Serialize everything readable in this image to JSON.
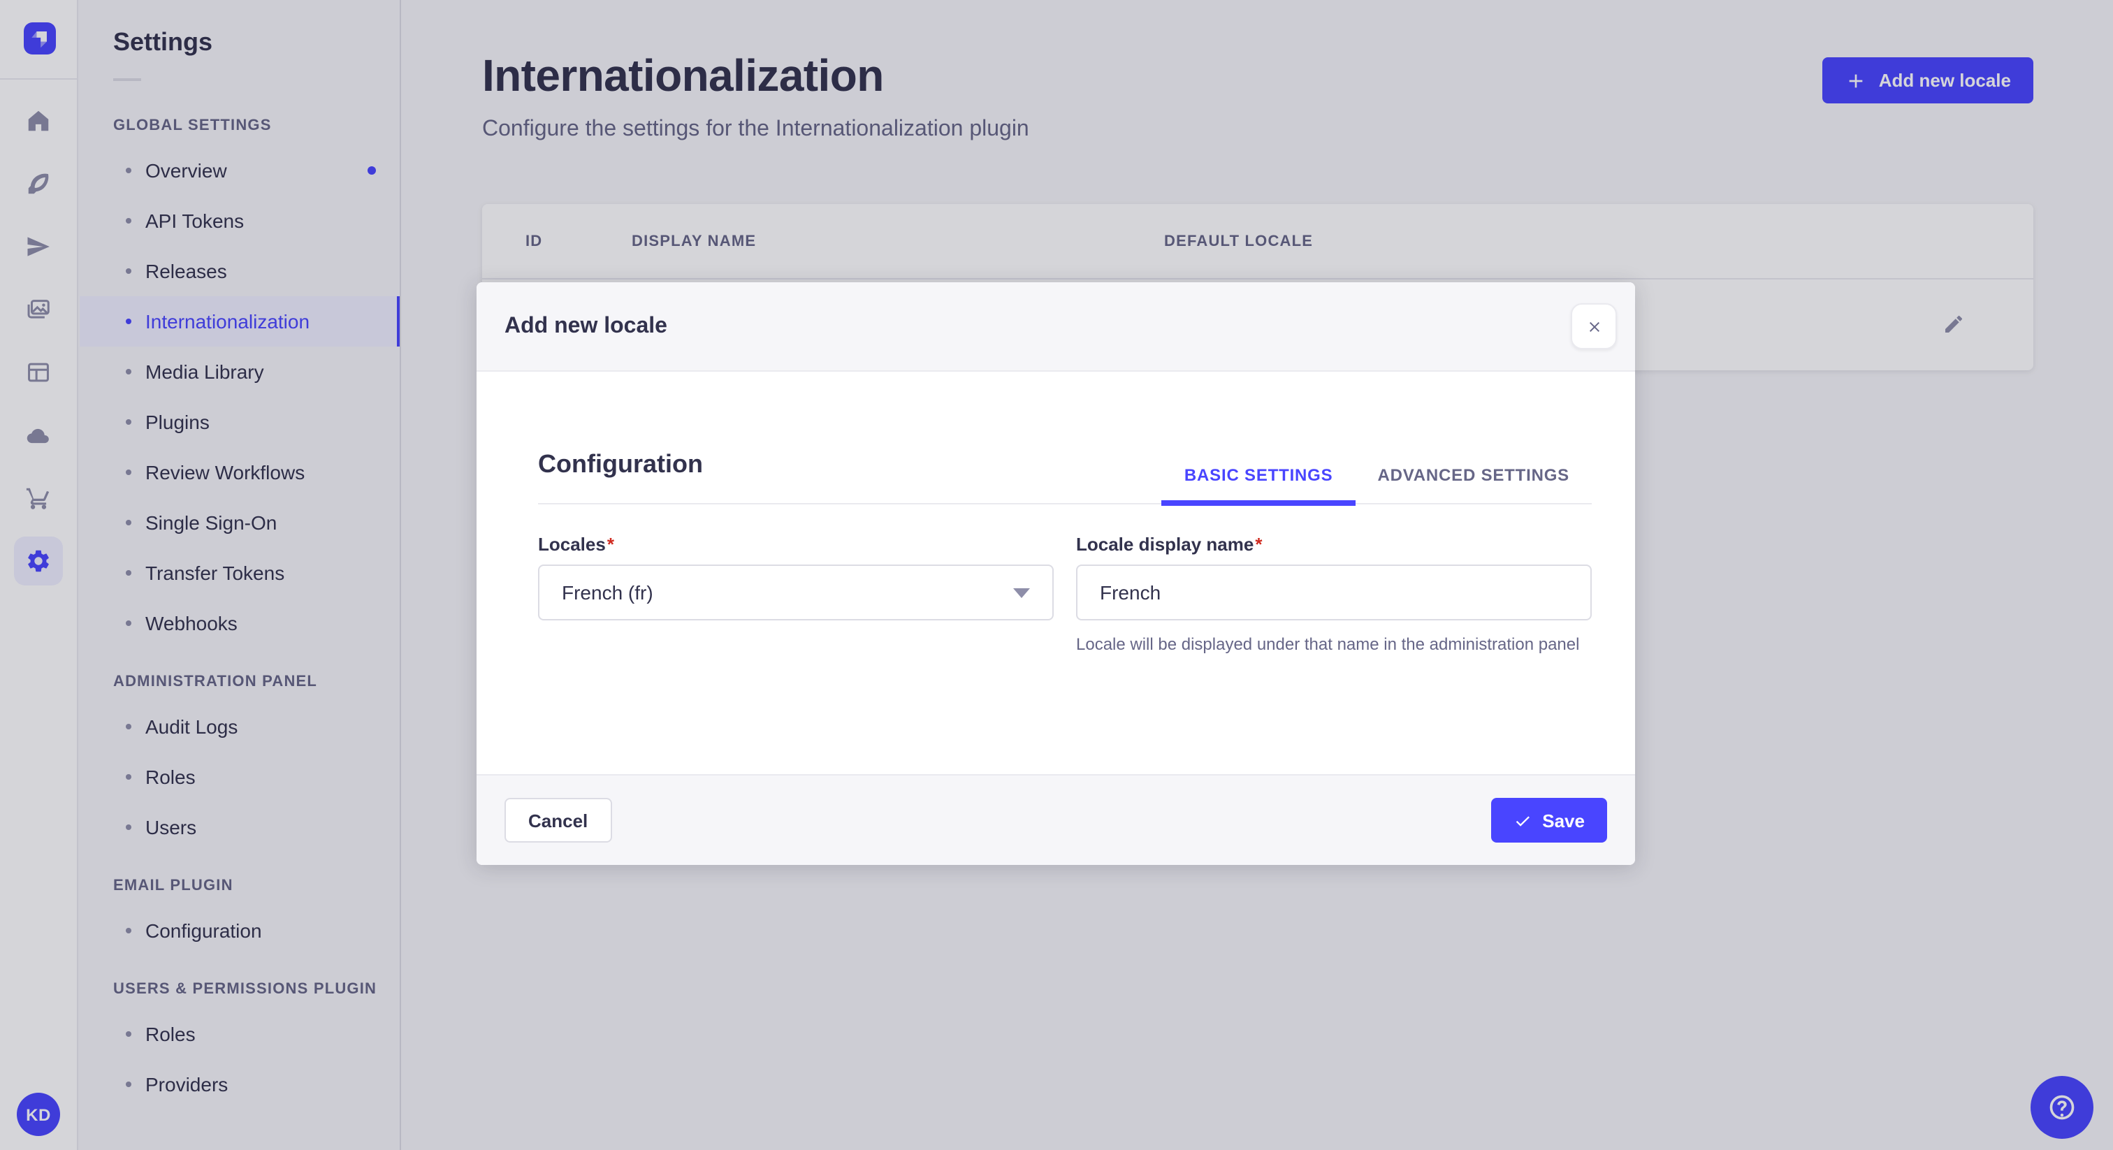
{
  "colors": {
    "primary": "#4945ff",
    "primary_light_bg": "#f0f0ff",
    "text_dark": "#32324d",
    "text_muted": "#666687",
    "icon_gray": "#8e8ea9",
    "border": "#dcdce4",
    "divider": "#eaeaef",
    "surface": "#ffffff",
    "app_bg": "#f6f6f9",
    "required_red": "#d02b20"
  },
  "rail": {
    "logo_icon": "strapi-logo",
    "icons": [
      {
        "name": "home",
        "glyph": "home",
        "active": false
      },
      {
        "name": "content-manager",
        "glyph": "feather",
        "active": false
      },
      {
        "name": "deploy",
        "glyph": "plane",
        "active": false
      },
      {
        "name": "media-library",
        "glyph": "media",
        "active": false
      },
      {
        "name": "content-type-builder",
        "glyph": "layout",
        "active": false
      },
      {
        "name": "cloud",
        "glyph": "cloud",
        "active": false
      },
      {
        "name": "marketplace",
        "glyph": "cart",
        "active": false
      },
      {
        "name": "settings-gear",
        "glyph": "gear",
        "active": true
      }
    ],
    "avatar_initials": "KD"
  },
  "subnav": {
    "title": "Settings",
    "sections": [
      {
        "label": "GLOBAL SETTINGS",
        "items": [
          {
            "label": "Overview",
            "notification": true
          },
          {
            "label": "API Tokens"
          },
          {
            "label": "Releases"
          },
          {
            "label": "Internationalization",
            "active": true
          },
          {
            "label": "Media Library"
          },
          {
            "label": "Plugins"
          },
          {
            "label": "Review Workflows"
          },
          {
            "label": "Single Sign-On"
          },
          {
            "label": "Transfer Tokens"
          },
          {
            "label": "Webhooks"
          }
        ]
      },
      {
        "label": "ADMINISTRATION PANEL",
        "items": [
          {
            "label": "Audit Logs"
          },
          {
            "label": "Roles"
          },
          {
            "label": "Users"
          }
        ]
      },
      {
        "label": "EMAIL PLUGIN",
        "items": [
          {
            "label": "Configuration"
          }
        ]
      },
      {
        "label": "USERS & PERMISSIONS PLUGIN",
        "items": [
          {
            "label": "Roles"
          },
          {
            "label": "Providers"
          }
        ]
      }
    ]
  },
  "page": {
    "title": "Internationalization",
    "subtitle": "Configure the settings for the Internationalization plugin",
    "add_button_label": "Add new locale",
    "table": {
      "columns": [
        "ID",
        "DISPLAY NAME",
        "DEFAULT LOCALE"
      ],
      "row_action_icon": "pencil-icon"
    }
  },
  "modal": {
    "title": "Add new locale",
    "close_icon": "close-icon",
    "section_title": "Configuration",
    "tabs": [
      {
        "label": "BASIC SETTINGS",
        "active": true
      },
      {
        "label": "ADVANCED SETTINGS",
        "active": false
      }
    ],
    "fields": {
      "locales": {
        "label": "Locales",
        "required_mark": "*",
        "value": "French (fr)",
        "caret_icon": "chevron-down-icon"
      },
      "display_name": {
        "label": "Locale display name",
        "required_mark": "*",
        "value": "French",
        "hint": "Locale will be displayed under that name in the administration panel"
      }
    },
    "cancel_label": "Cancel",
    "save_label": "Save",
    "save_icon": "check-icon"
  },
  "help": {
    "icon": "question-circle-icon"
  }
}
